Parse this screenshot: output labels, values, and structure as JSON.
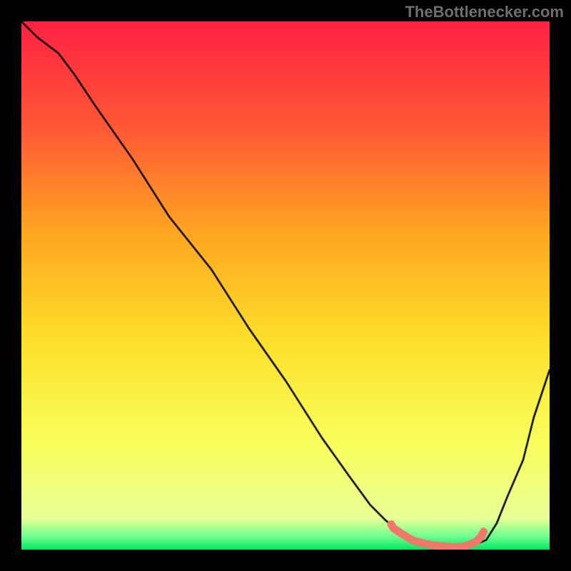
{
  "watermark": "TheBottlenecker.com",
  "chart_data": {
    "type": "line",
    "title": "",
    "xlabel": "",
    "ylabel": "",
    "xlim": [
      0,
      1
    ],
    "ylim": [
      0,
      1
    ],
    "series": [
      {
        "name": "bottleneck-curve",
        "x": [
          0.0,
          0.03,
          0.07,
          0.1,
          0.14,
          0.21,
          0.28,
          0.36,
          0.43,
          0.5,
          0.57,
          0.62,
          0.66,
          0.69,
          0.72,
          0.76,
          0.79,
          0.82,
          0.85,
          0.88,
          0.9,
          0.92,
          0.95,
          0.97,
          1.0
        ],
        "y": [
          1.0,
          0.97,
          0.94,
          0.9,
          0.84,
          0.74,
          0.63,
          0.53,
          0.42,
          0.32,
          0.21,
          0.14,
          0.085,
          0.055,
          0.03,
          0.012,
          0.006,
          0.004,
          0.006,
          0.018,
          0.05,
          0.1,
          0.17,
          0.25,
          0.34
        ],
        "color": "#000000"
      },
      {
        "name": "optimal-range-highlight",
        "x": [
          0.7,
          0.705,
          0.72,
          0.74,
          0.76,
          0.78,
          0.8,
          0.82,
          0.84,
          0.86,
          0.87,
          0.875
        ],
        "y": [
          0.048,
          0.04,
          0.03,
          0.018,
          0.012,
          0.008,
          0.006,
          0.004,
          0.006,
          0.014,
          0.024,
          0.034
        ],
        "color": "#f1776a"
      }
    ],
    "background_gradient": {
      "stops": [
        {
          "pos": 0.0,
          "color": "#ff2243"
        },
        {
          "pos": 0.2,
          "color": "#ff5836"
        },
        {
          "pos": 0.4,
          "color": "#ffa621"
        },
        {
          "pos": 0.6,
          "color": "#fddf2a"
        },
        {
          "pos": 0.8,
          "color": "#f9ff5d"
        },
        {
          "pos": 0.94,
          "color": "#eaff96"
        },
        {
          "pos": 0.975,
          "color": "#70ff8f"
        },
        {
          "pos": 1.0,
          "color": "#00e863"
        }
      ]
    }
  }
}
